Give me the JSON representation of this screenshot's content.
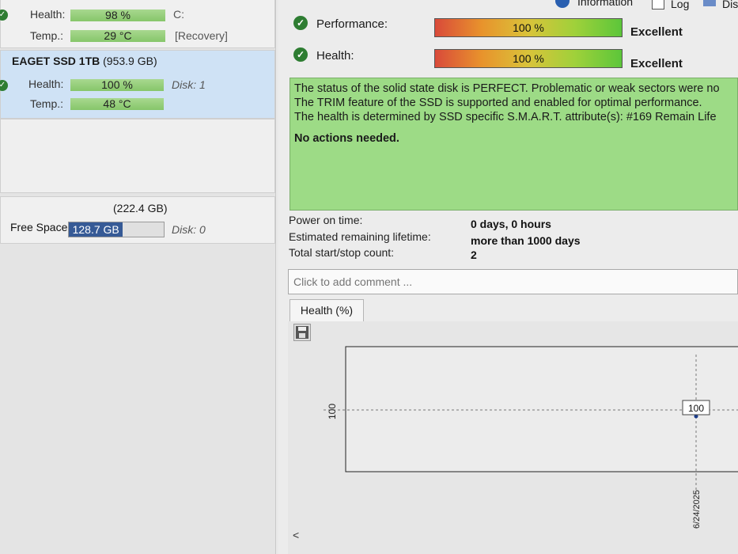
{
  "left": {
    "disk0_partial": {
      "health_label": "Health:",
      "health_value": "98 %",
      "drive": "C:",
      "temp_label": "Temp.:",
      "temp_value": "29 °C",
      "note": "[Recovery]"
    },
    "disk1": {
      "title": "EAGET SSD 1TB",
      "size": "(953.9 GB)",
      "health_label": "Health:",
      "health_value": "100 %",
      "disk_label": "Disk: 1",
      "temp_label": "Temp.:",
      "temp_value": "48 °C"
    },
    "volume": {
      "size": "(222.4 GB)",
      "free_label": "Free Space",
      "free_value": "128.7 GB",
      "free_fraction": 0.57,
      "disk_label": "Disk: 0"
    }
  },
  "toolbar": {
    "information": "Information",
    "log": "Log",
    "disk": "Dis"
  },
  "metrics": [
    {
      "label": "Performance:",
      "value": "100 %",
      "fraction": 1.0,
      "rating": "Excellent"
    },
    {
      "label": "Health:",
      "value": "100 %",
      "fraction": 1.0,
      "rating": "Excellent"
    }
  ],
  "status": {
    "lines": [
      "The status of the solid state disk is PERFECT. Problematic or weak sectors were no",
      "The TRIM feature of the SSD is supported and enabled for optimal performance.",
      "The health is determined by SSD specific S.M.A.R.T. attribute(s):  #169 Remain Life"
    ],
    "action": "No actions needed."
  },
  "info": [
    {
      "key": "Power on time:",
      "value": "0 days, 0 hours"
    },
    {
      "key": "Estimated remaining lifetime:",
      "value": "more than 1000 days"
    },
    {
      "key": "Total start/stop count:",
      "value": "2"
    }
  ],
  "comment_placeholder": "Click to add comment ...",
  "tab_label": "Health (%)",
  "colors": {
    "status_green": "#9ddb86",
    "selected_blue": "#cfe2f5",
    "free_space_fill": "#365a96"
  },
  "chart_data": {
    "type": "line",
    "title": "",
    "xlabel": "",
    "ylabel": "",
    "y_tick_labels": [
      "100"
    ],
    "x_tick_labels": [
      "6/24/2025"
    ],
    "series": [
      {
        "x": [
          "6/24/2025"
        ],
        "values": [
          100
        ]
      }
    ],
    "data_labels": [
      "100"
    ],
    "grid": true
  }
}
